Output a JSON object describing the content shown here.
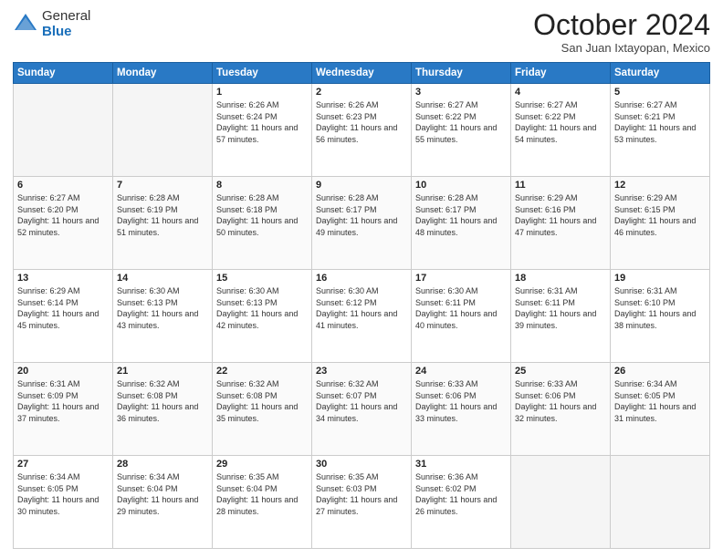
{
  "header": {
    "logo_general": "General",
    "logo_blue": "Blue",
    "month_title": "October 2024",
    "location": "San Juan Ixtayopan, Mexico"
  },
  "days_of_week": [
    "Sunday",
    "Monday",
    "Tuesday",
    "Wednesday",
    "Thursday",
    "Friday",
    "Saturday"
  ],
  "weeks": [
    [
      {
        "day": "",
        "empty": true
      },
      {
        "day": "",
        "empty": true
      },
      {
        "day": "1",
        "sunrise": "6:26 AM",
        "sunset": "6:24 PM",
        "daylight": "11 hours and 57 minutes."
      },
      {
        "day": "2",
        "sunrise": "6:26 AM",
        "sunset": "6:23 PM",
        "daylight": "11 hours and 56 minutes."
      },
      {
        "day": "3",
        "sunrise": "6:27 AM",
        "sunset": "6:22 PM",
        "daylight": "11 hours and 55 minutes."
      },
      {
        "day": "4",
        "sunrise": "6:27 AM",
        "sunset": "6:22 PM",
        "daylight": "11 hours and 54 minutes."
      },
      {
        "day": "5",
        "sunrise": "6:27 AM",
        "sunset": "6:21 PM",
        "daylight": "11 hours and 53 minutes."
      }
    ],
    [
      {
        "day": "6",
        "sunrise": "6:27 AM",
        "sunset": "6:20 PM",
        "daylight": "11 hours and 52 minutes."
      },
      {
        "day": "7",
        "sunrise": "6:28 AM",
        "sunset": "6:19 PM",
        "daylight": "11 hours and 51 minutes."
      },
      {
        "day": "8",
        "sunrise": "6:28 AM",
        "sunset": "6:18 PM",
        "daylight": "11 hours and 50 minutes."
      },
      {
        "day": "9",
        "sunrise": "6:28 AM",
        "sunset": "6:17 PM",
        "daylight": "11 hours and 49 minutes."
      },
      {
        "day": "10",
        "sunrise": "6:28 AM",
        "sunset": "6:17 PM",
        "daylight": "11 hours and 48 minutes."
      },
      {
        "day": "11",
        "sunrise": "6:29 AM",
        "sunset": "6:16 PM",
        "daylight": "11 hours and 47 minutes."
      },
      {
        "day": "12",
        "sunrise": "6:29 AM",
        "sunset": "6:15 PM",
        "daylight": "11 hours and 46 minutes."
      }
    ],
    [
      {
        "day": "13",
        "sunrise": "6:29 AM",
        "sunset": "6:14 PM",
        "daylight": "11 hours and 45 minutes."
      },
      {
        "day": "14",
        "sunrise": "6:30 AM",
        "sunset": "6:13 PM",
        "daylight": "11 hours and 43 minutes."
      },
      {
        "day": "15",
        "sunrise": "6:30 AM",
        "sunset": "6:13 PM",
        "daylight": "11 hours and 42 minutes."
      },
      {
        "day": "16",
        "sunrise": "6:30 AM",
        "sunset": "6:12 PM",
        "daylight": "11 hours and 41 minutes."
      },
      {
        "day": "17",
        "sunrise": "6:30 AM",
        "sunset": "6:11 PM",
        "daylight": "11 hours and 40 minutes."
      },
      {
        "day": "18",
        "sunrise": "6:31 AM",
        "sunset": "6:11 PM",
        "daylight": "11 hours and 39 minutes."
      },
      {
        "day": "19",
        "sunrise": "6:31 AM",
        "sunset": "6:10 PM",
        "daylight": "11 hours and 38 minutes."
      }
    ],
    [
      {
        "day": "20",
        "sunrise": "6:31 AM",
        "sunset": "6:09 PM",
        "daylight": "11 hours and 37 minutes."
      },
      {
        "day": "21",
        "sunrise": "6:32 AM",
        "sunset": "6:08 PM",
        "daylight": "11 hours and 36 minutes."
      },
      {
        "day": "22",
        "sunrise": "6:32 AM",
        "sunset": "6:08 PM",
        "daylight": "11 hours and 35 minutes."
      },
      {
        "day": "23",
        "sunrise": "6:32 AM",
        "sunset": "6:07 PM",
        "daylight": "11 hours and 34 minutes."
      },
      {
        "day": "24",
        "sunrise": "6:33 AM",
        "sunset": "6:06 PM",
        "daylight": "11 hours and 33 minutes."
      },
      {
        "day": "25",
        "sunrise": "6:33 AM",
        "sunset": "6:06 PM",
        "daylight": "11 hours and 32 minutes."
      },
      {
        "day": "26",
        "sunrise": "6:34 AM",
        "sunset": "6:05 PM",
        "daylight": "11 hours and 31 minutes."
      }
    ],
    [
      {
        "day": "27",
        "sunrise": "6:34 AM",
        "sunset": "6:05 PM",
        "daylight": "11 hours and 30 minutes."
      },
      {
        "day": "28",
        "sunrise": "6:34 AM",
        "sunset": "6:04 PM",
        "daylight": "11 hours and 29 minutes."
      },
      {
        "day": "29",
        "sunrise": "6:35 AM",
        "sunset": "6:04 PM",
        "daylight": "11 hours and 28 minutes."
      },
      {
        "day": "30",
        "sunrise": "6:35 AM",
        "sunset": "6:03 PM",
        "daylight": "11 hours and 27 minutes."
      },
      {
        "day": "31",
        "sunrise": "6:36 AM",
        "sunset": "6:02 PM",
        "daylight": "11 hours and 26 minutes."
      },
      {
        "day": "",
        "empty": true
      },
      {
        "day": "",
        "empty": true
      }
    ]
  ]
}
